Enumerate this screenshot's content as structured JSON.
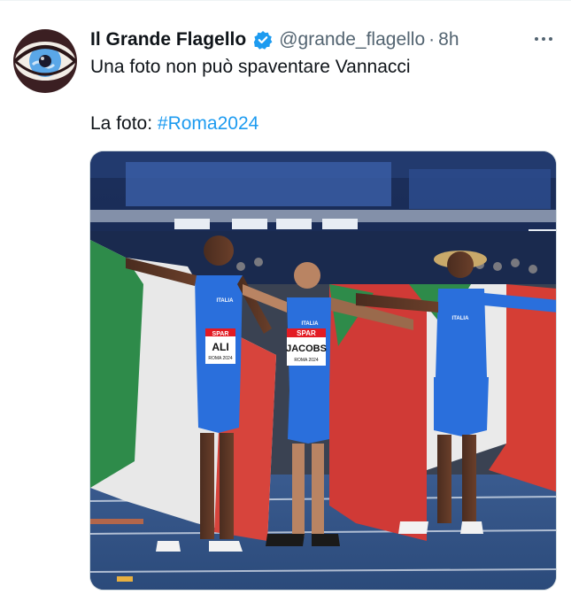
{
  "tweet": {
    "author_name": "Il Grande Flagello",
    "handle": "@grande_flagello",
    "separator": "·",
    "time": "8h",
    "line1": "Una foto non può spaventare Vannacci",
    "line2_prefix": "La foto: ",
    "hashtag": "#Roma2024"
  },
  "icons": {
    "verified": "verified-badge-icon",
    "more": "more-options-icon",
    "avatar": "eye-avatar"
  },
  "photo": {
    "bib_left_name": "ALI",
    "bib_center_name": "JACOBS",
    "bib_sponsor": "SPAR",
    "bib_event": "ROMA 2024",
    "jersey_text": "ITALIA"
  },
  "colors": {
    "accent": "#1d9bf0",
    "text": "#0f1419",
    "muted": "#536471",
    "jersey": "#2a6fdc"
  }
}
